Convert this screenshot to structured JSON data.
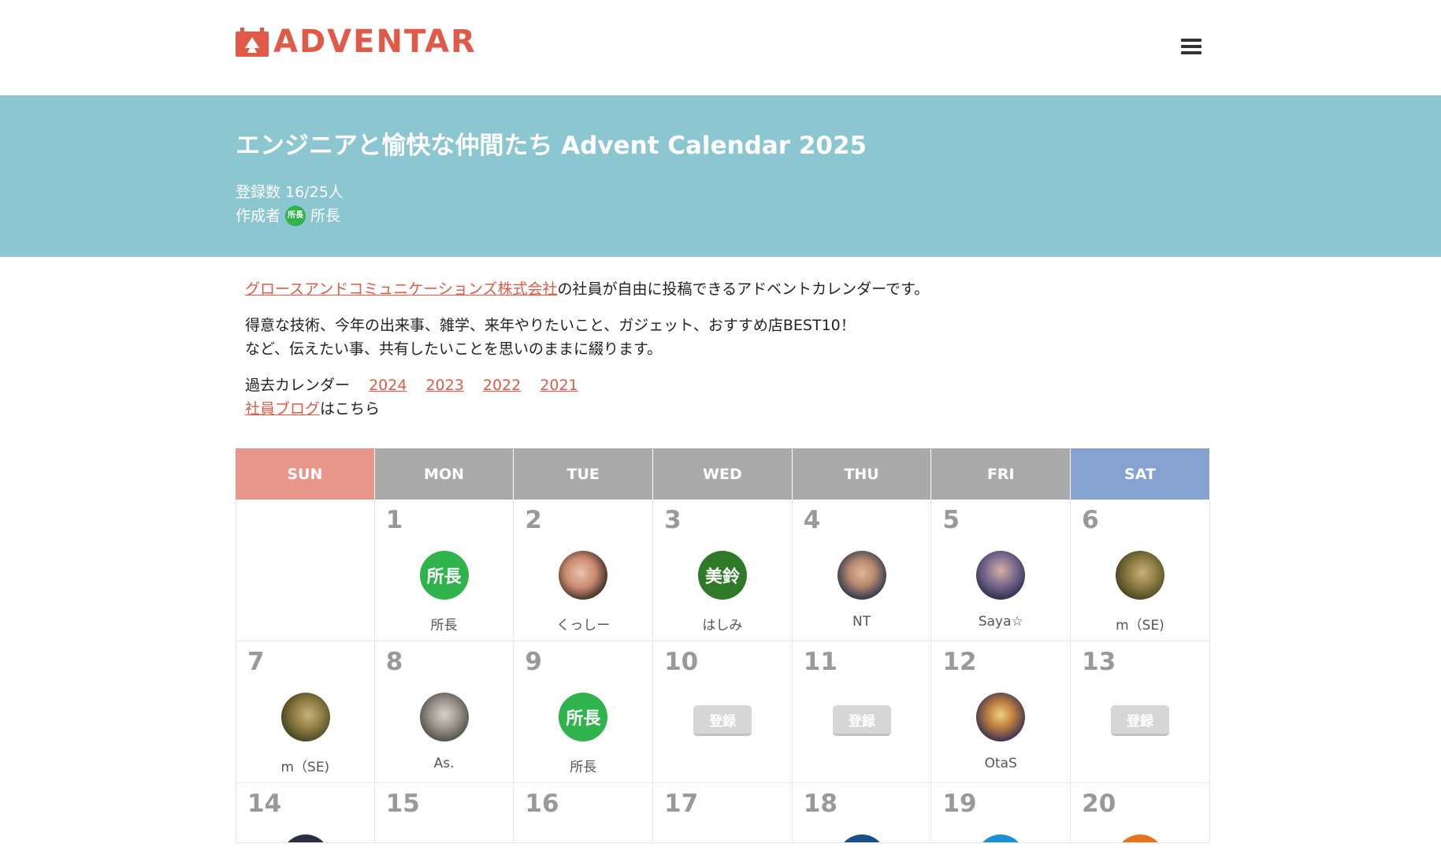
{
  "header": {
    "logo_text": "ADVENTAR",
    "logo_color": "#e05a47"
  },
  "banner": {
    "title": "エンジニアと愉快な仲間たち Advent Calendar 2025",
    "registered_label": "登録数 16/25人",
    "author_label": "作成者",
    "author_avatar_text": "所長",
    "author_name": "所長",
    "bg_color": "#8cc6d1"
  },
  "description": {
    "company_link": "グロースアンドコミュニケーションズ株式会社",
    "line1_rest": "の社員が自由に投稿できるアドベントカレンダーです。",
    "line2": "得意な技術、今年の出来事、雑学、来年やりたいこと、ガジェット、おすすめ店BEST10！",
    "line3": "など、伝えたい事、共有したいことを思いのままに綴ります。",
    "past_label": "過去カレンダー",
    "past_years": [
      "2024",
      "2023",
      "2022",
      "2021"
    ],
    "blog_link": "社員ブログ",
    "blog_rest": "はこちら"
  },
  "calendar": {
    "headers": [
      "SUN",
      "MON",
      "TUE",
      "WED",
      "THU",
      "FRI",
      "SAT"
    ],
    "register_label": "登録",
    "days": {
      "d1": {
        "num": "1",
        "name": "所長",
        "avatar_text": "所長"
      },
      "d2": {
        "num": "2",
        "name": "くっしー"
      },
      "d3": {
        "num": "3",
        "name": "はしみ",
        "avatar_text": "美鈴"
      },
      "d4": {
        "num": "4",
        "name": "NT"
      },
      "d5": {
        "num": "5",
        "name": "Saya☆"
      },
      "d6": {
        "num": "6",
        "name": "m（SE)"
      },
      "d7": {
        "num": "7",
        "name": "m（SE)"
      },
      "d8": {
        "num": "8",
        "name": "As."
      },
      "d9": {
        "num": "9",
        "name": "所長",
        "avatar_text": "所長"
      },
      "d10": {
        "num": "10"
      },
      "d11": {
        "num": "11"
      },
      "d12": {
        "num": "12",
        "name": "OtaS"
      },
      "d13": {
        "num": "13"
      },
      "d14": {
        "num": "14"
      },
      "d15": {
        "num": "15"
      },
      "d16": {
        "num": "16"
      },
      "d17": {
        "num": "17"
      },
      "d18": {
        "num": "18"
      },
      "d19": {
        "num": "19"
      },
      "d20": {
        "num": "20"
      }
    }
  }
}
